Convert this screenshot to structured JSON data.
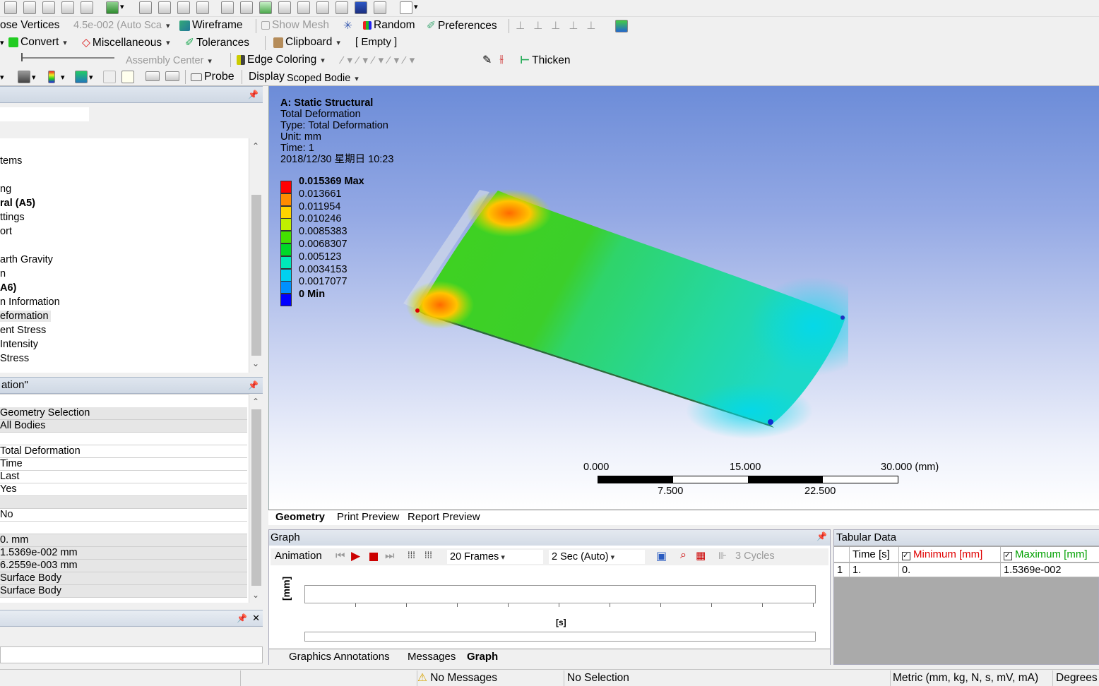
{
  "toolbar2": {
    "close_vertices": "ose Vertices",
    "scale_value": "4.5e-002 (Auto Sca",
    "wireframe": "Wireframe",
    "show_mesh": "Show Mesh",
    "random": "Random",
    "preferences": "Preferences"
  },
  "toolbar3": {
    "convert": "Convert",
    "miscellaneous": "Miscellaneous",
    "tolerances": "Tolerances",
    "clipboard": "Clipboard",
    "clipboard_state": "[ Empty ]"
  },
  "toolbar4": {
    "assembly_center": "Assembly Center",
    "edge_coloring": "Edge Coloring",
    "thicken": "Thicken"
  },
  "toolbar5": {
    "probe": "Probe",
    "display": "Display",
    "scoped_bodies": "Scoped Bodie"
  },
  "outline": {
    "tree_items": [
      "tems",
      "ng",
      "ral (A5)",
      "ttings",
      "ort",
      "arth Gravity",
      "n",
      "A6)",
      "n Information",
      "eformation",
      "ent Stress",
      "Intensity",
      "Stress"
    ]
  },
  "details": {
    "title": "ation\"",
    "rows": [
      "Geometry Selection",
      "All Bodies",
      "",
      "Total Deformation",
      "Time",
      "Last",
      "Yes",
      "",
      "No",
      "",
      "0. mm",
      "1.5369e-002 mm",
      "6.2559e-003 mm",
      "Surface Body",
      "Surface Body"
    ]
  },
  "viewport": {
    "title": "A: Static Structural",
    "result_name": "Total Deformation",
    "type_line": "Type: Total Deformation",
    "unit_line": "Unit: mm",
    "time_line": "Time: 1",
    "date_line": "2018/12/30 星期日 10:23",
    "legend": [
      {
        "label": "0.015369 Max",
        "color": "#ff0000",
        "bold": true
      },
      {
        "label": "0.013661",
        "color": "#ff8c00"
      },
      {
        "label": "0.011954",
        "color": "#ffd400"
      },
      {
        "label": "0.010246",
        "color": "#c0f000"
      },
      {
        "label": "0.0085383",
        "color": "#44e000"
      },
      {
        "label": "0.0068307",
        "color": "#00d828"
      },
      {
        "label": "0.005123",
        "color": "#00e8b8"
      },
      {
        "label": "0.0034153",
        "color": "#00d0f0"
      },
      {
        "label": "0.0017077",
        "color": "#0090ff"
      },
      {
        "label": "0 Min",
        "color": "#0000ff",
        "bold": true
      }
    ],
    "scale_top": [
      "0.000",
      "15.000",
      "30.000 (mm)"
    ],
    "scale_bottom": [
      "7.500",
      "22.500"
    ]
  },
  "view_tabs": [
    "Geometry",
    "Print Preview",
    "Report Preview"
  ],
  "graph": {
    "title": "Graph",
    "animation": "Animation",
    "frames": "20 Frames",
    "duration": "2 Sec (Auto)",
    "cycles": "3 Cycles",
    "yaxis": "[mm]",
    "xaxis": "[s]"
  },
  "bottom_tabs": [
    "Graphics Annotations",
    "Messages",
    "Graph"
  ],
  "tabular": {
    "title": "Tabular Data",
    "headers": [
      "Time [s]",
      "Minimum [mm]",
      "Maximum [mm]"
    ],
    "row": [
      "1",
      "1.",
      "0.",
      "1.5369e-002"
    ],
    "min_color": "#e00000",
    "max_color": "#00a000"
  },
  "status": {
    "messages": "No Messages",
    "selection": "No Selection",
    "units": "Metric (mm, kg, N, s, mV, mA)",
    "angle": "Degrees"
  }
}
